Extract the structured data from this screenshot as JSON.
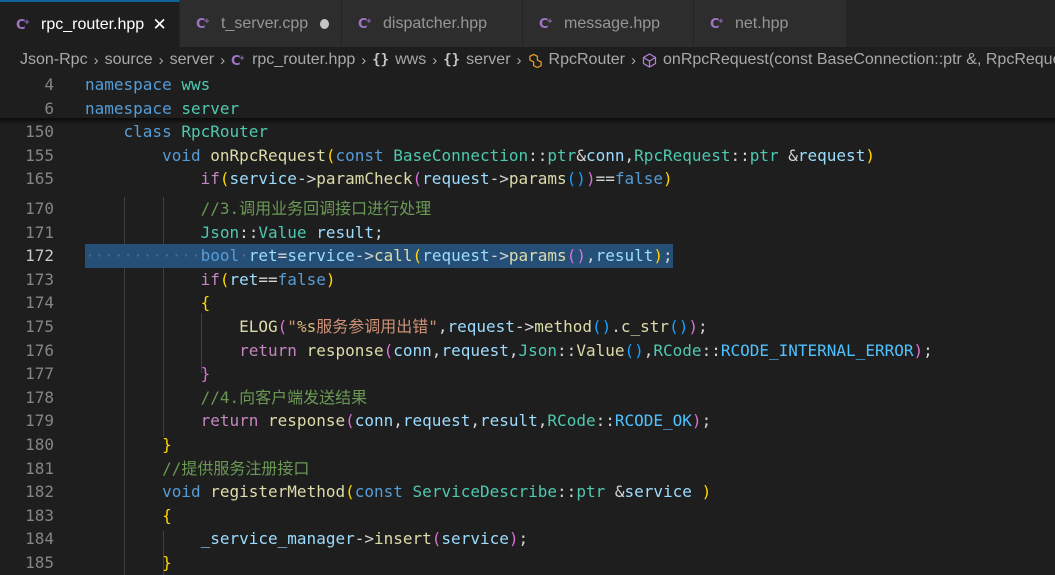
{
  "tabs": [
    {
      "label": "rpc_router.hpp",
      "icon": "cpp-file-icon",
      "active": true,
      "status": "close"
    },
    {
      "label": "t_server.cpp",
      "icon": "cpp-file-icon",
      "active": false,
      "status": "modified"
    },
    {
      "label": "dispatcher.hpp",
      "icon": "cpp-file-icon",
      "active": false,
      "status": "none"
    },
    {
      "label": "message.hpp",
      "icon": "cpp-file-icon",
      "active": false,
      "status": "none"
    },
    {
      "label": "net.hpp",
      "icon": "cpp-file-icon",
      "active": false,
      "status": "none"
    }
  ],
  "breadcrumb": {
    "items": [
      {
        "label": "Json-Rpc",
        "icon": ""
      },
      {
        "label": "source",
        "icon": ""
      },
      {
        "label": "server",
        "icon": ""
      },
      {
        "label": "rpc_router.hpp",
        "icon": "cpp-file-icon"
      },
      {
        "label": "wws",
        "icon": "namespace-icon"
      },
      {
        "label": "server",
        "icon": "namespace-icon"
      },
      {
        "label": "RpcRouter",
        "icon": "class-icon"
      },
      {
        "label": "onRpcRequest(const BaseConnection::ptr &, RpcRequest::ptr &)",
        "icon": "method-icon"
      }
    ],
    "separator": "›",
    "namespace_glyph": "{}"
  },
  "editor": {
    "current_line": "172",
    "selection_line": "172",
    "sticky_lines": [
      {
        "num": "4",
        "tokens": [
          [
            "kw",
            "namespace"
          ],
          [
            "txt",
            " "
          ],
          [
            "ty",
            "wws"
          ]
        ]
      },
      {
        "num": "6",
        "tokens": [
          [
            "kw",
            "namespace"
          ],
          [
            "txt",
            " "
          ],
          [
            "ty",
            "server"
          ]
        ]
      },
      {
        "num": "150",
        "tokens": [
          [
            "txt",
            "    "
          ],
          [
            "kw",
            "class"
          ],
          [
            "txt",
            " "
          ],
          [
            "ty",
            "RpcRouter"
          ]
        ]
      },
      {
        "num": "155",
        "tokens": [
          [
            "txt",
            "        "
          ],
          [
            "kw",
            "void"
          ],
          [
            "txt",
            " "
          ],
          [
            "fn",
            "onRpcRequest"
          ],
          [
            "p1",
            "("
          ],
          [
            "kw",
            "const"
          ],
          [
            "txt",
            " "
          ],
          [
            "ty",
            "BaseConnection"
          ],
          [
            "txt",
            "::"
          ],
          [
            "ty",
            "ptr"
          ],
          [
            "txt",
            "&"
          ],
          [
            "var",
            "conn"
          ],
          [
            "txt",
            ","
          ],
          [
            "ty",
            "RpcRequest"
          ],
          [
            "txt",
            "::"
          ],
          [
            "ty",
            "ptr"
          ],
          [
            "txt",
            " &"
          ],
          [
            "var",
            "request"
          ],
          [
            "p1",
            ")"
          ]
        ]
      },
      {
        "num": "165",
        "tokens": [
          [
            "txt",
            "            "
          ],
          [
            "ctl",
            "if"
          ],
          [
            "p1",
            "("
          ],
          [
            "var",
            "service"
          ],
          [
            "txt",
            "->"
          ],
          [
            "fn",
            "paramCheck"
          ],
          [
            "p2",
            "("
          ],
          [
            "var",
            "request"
          ],
          [
            "txt",
            "->"
          ],
          [
            "fn",
            "params"
          ],
          [
            "p3",
            "()"
          ],
          [
            "p2",
            ")"
          ],
          [
            "txt",
            "=="
          ],
          [
            "kw",
            "false"
          ],
          [
            "p1",
            ")"
          ]
        ]
      }
    ],
    "lines": [
      {
        "num": "170",
        "tokens": [
          [
            "txt",
            "            "
          ],
          [
            "cm",
            "//3.调用业务回调接口进行处理"
          ]
        ]
      },
      {
        "num": "171",
        "tokens": [
          [
            "txt",
            "            "
          ],
          [
            "ty",
            "Json"
          ],
          [
            "txt",
            "::"
          ],
          [
            "ty",
            "Value"
          ],
          [
            "txt",
            " "
          ],
          [
            "var",
            "result"
          ],
          [
            "txt",
            ";"
          ]
        ]
      },
      {
        "num": "172",
        "tokens": [
          [
            "ws",
            "············"
          ],
          [
            "kw",
            "bool"
          ],
          [
            "ws",
            "·"
          ],
          [
            "var",
            "ret"
          ],
          [
            "txt",
            "="
          ],
          [
            "var",
            "service"
          ],
          [
            "txt",
            "->"
          ],
          [
            "fn",
            "call"
          ],
          [
            "p1",
            "("
          ],
          [
            "var",
            "request"
          ],
          [
            "txt",
            "->"
          ],
          [
            "fn",
            "params"
          ],
          [
            "p2",
            "()"
          ],
          [
            "txt",
            ","
          ],
          [
            "var",
            "result"
          ],
          [
            "p1",
            ")"
          ],
          [
            "txt",
            ";"
          ]
        ]
      },
      {
        "num": "173",
        "tokens": [
          [
            "txt",
            "            "
          ],
          [
            "ctl",
            "if"
          ],
          [
            "p1",
            "("
          ],
          [
            "var",
            "ret"
          ],
          [
            "txt",
            "=="
          ],
          [
            "kw",
            "false"
          ],
          [
            "p1",
            ")"
          ]
        ]
      },
      {
        "num": "174",
        "tokens": [
          [
            "txt",
            "            "
          ],
          [
            "p1",
            "{"
          ]
        ]
      },
      {
        "num": "175",
        "tokens": [
          [
            "txt",
            "                "
          ],
          [
            "fn",
            "ELOG"
          ],
          [
            "p2",
            "("
          ],
          [
            "str",
            "\""
          ],
          [
            "esc",
            "%s"
          ],
          [
            "str",
            "服务参调用出错\""
          ],
          [
            "txt",
            ","
          ],
          [
            "var",
            "request"
          ],
          [
            "txt",
            "->"
          ],
          [
            "fn",
            "method"
          ],
          [
            "p3",
            "()"
          ],
          [
            "txt",
            "."
          ],
          [
            "fn",
            "c_str"
          ],
          [
            "p3",
            "()"
          ],
          [
            "p2",
            ")"
          ],
          [
            "txt",
            ";"
          ]
        ]
      },
      {
        "num": "176",
        "tokens": [
          [
            "txt",
            "                "
          ],
          [
            "ctl",
            "return"
          ],
          [
            "txt",
            " "
          ],
          [
            "fn",
            "response"
          ],
          [
            "p2",
            "("
          ],
          [
            "var",
            "conn"
          ],
          [
            "txt",
            ","
          ],
          [
            "var",
            "request"
          ],
          [
            "txt",
            ","
          ],
          [
            "ty",
            "Json"
          ],
          [
            "txt",
            "::"
          ],
          [
            "fn",
            "Value"
          ],
          [
            "p3",
            "()"
          ],
          [
            "txt",
            ","
          ],
          [
            "ty",
            "RCode"
          ],
          [
            "txt",
            "::"
          ],
          [
            "enm",
            "RCODE_INTERNAL_ERROR"
          ],
          [
            "p2",
            ")"
          ],
          [
            "txt",
            ";"
          ]
        ]
      },
      {
        "num": "177",
        "tokens": [
          [
            "txt",
            "            "
          ],
          [
            "p2",
            "}"
          ]
        ]
      },
      {
        "num": "178",
        "tokens": [
          [
            "txt",
            "            "
          ],
          [
            "cm",
            "//4.向客户端发送结果"
          ]
        ]
      },
      {
        "num": "179",
        "tokens": [
          [
            "txt",
            "            "
          ],
          [
            "ctl",
            "return"
          ],
          [
            "txt",
            " "
          ],
          [
            "fn",
            "response"
          ],
          [
            "p2",
            "("
          ],
          [
            "var",
            "conn"
          ],
          [
            "txt",
            ","
          ],
          [
            "var",
            "request"
          ],
          [
            "txt",
            ","
          ],
          [
            "var",
            "result"
          ],
          [
            "txt",
            ","
          ],
          [
            "ty",
            "RCode"
          ],
          [
            "txt",
            "::"
          ],
          [
            "enm",
            "RCODE_OK"
          ],
          [
            "p2",
            ")"
          ],
          [
            "txt",
            ";"
          ]
        ]
      },
      {
        "num": "180",
        "tokens": [
          [
            "txt",
            "        "
          ],
          [
            "p1",
            "}"
          ]
        ]
      },
      {
        "num": "181",
        "tokens": [
          [
            "txt",
            "        "
          ],
          [
            "cm",
            "//提供服务注册接口"
          ]
        ]
      },
      {
        "num": "182",
        "tokens": [
          [
            "txt",
            "        "
          ],
          [
            "kw",
            "void"
          ],
          [
            "txt",
            " "
          ],
          [
            "fn",
            "registerMethod"
          ],
          [
            "p1",
            "("
          ],
          [
            "kw",
            "const"
          ],
          [
            "txt",
            " "
          ],
          [
            "ty",
            "ServiceDescribe"
          ],
          [
            "txt",
            "::"
          ],
          [
            "ty",
            "ptr"
          ],
          [
            "txt",
            " &"
          ],
          [
            "var",
            "service"
          ],
          [
            "txt",
            " "
          ],
          [
            "p1",
            ")"
          ]
        ]
      },
      {
        "num": "183",
        "tokens": [
          [
            "txt",
            "        "
          ],
          [
            "p1",
            "{"
          ]
        ]
      },
      {
        "num": "184",
        "tokens": [
          [
            "txt",
            "            "
          ],
          [
            "var",
            "_service_manager"
          ],
          [
            "txt",
            "->"
          ],
          [
            "fn",
            "insert"
          ],
          [
            "p2",
            "("
          ],
          [
            "var",
            "service"
          ],
          [
            "p2",
            ")"
          ],
          [
            "txt",
            ";"
          ]
        ]
      },
      {
        "num": "185",
        "tokens": [
          [
            "txt",
            "        "
          ],
          [
            "p1",
            "}"
          ]
        ]
      }
    ]
  }
}
